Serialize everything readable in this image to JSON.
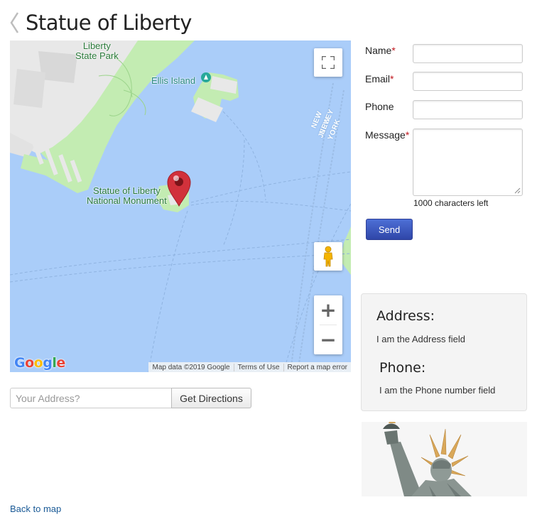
{
  "page": {
    "title": "Statue of Liberty",
    "back_link": "Back to map"
  },
  "map": {
    "labels": {
      "liberty_state_park": "Liberty\nState Park",
      "ellis_island": "Ellis Island",
      "statue_monument": "Statue of Liberty\nNational Monument",
      "new_jersey": "NEW JERSEY",
      "new_york": "NEW YORK"
    },
    "zoom_in": "+",
    "zoom_out": "−",
    "logo": [
      "G",
      "o",
      "o",
      "g",
      "l",
      "e"
    ],
    "logo_colors": [
      "#4285f4",
      "#ea4335",
      "#fbbc05",
      "#4285f4",
      "#34a853",
      "#ea4335"
    ],
    "attribution": {
      "data": "Map data ©2019 Google",
      "terms": "Terms of Use",
      "report": "Report a map error"
    },
    "colors": {
      "water": "#aacdf9",
      "park": "#c3ecb2",
      "urban": "#e8e8e8",
      "marker": "#d1313b"
    }
  },
  "directions": {
    "placeholder": "Your Address?",
    "button": "Get Directions"
  },
  "contact_form": {
    "name_label": "Name",
    "email_label": "Email",
    "phone_label": "Phone",
    "message_label": "Message",
    "required_mark": "*",
    "chars_left": "1000 characters left",
    "send": "Send"
  },
  "info": {
    "address_heading": "Address:",
    "address_value": "I am the Address field",
    "phone_heading": "Phone:",
    "phone_value": "I am the Phone number field"
  }
}
